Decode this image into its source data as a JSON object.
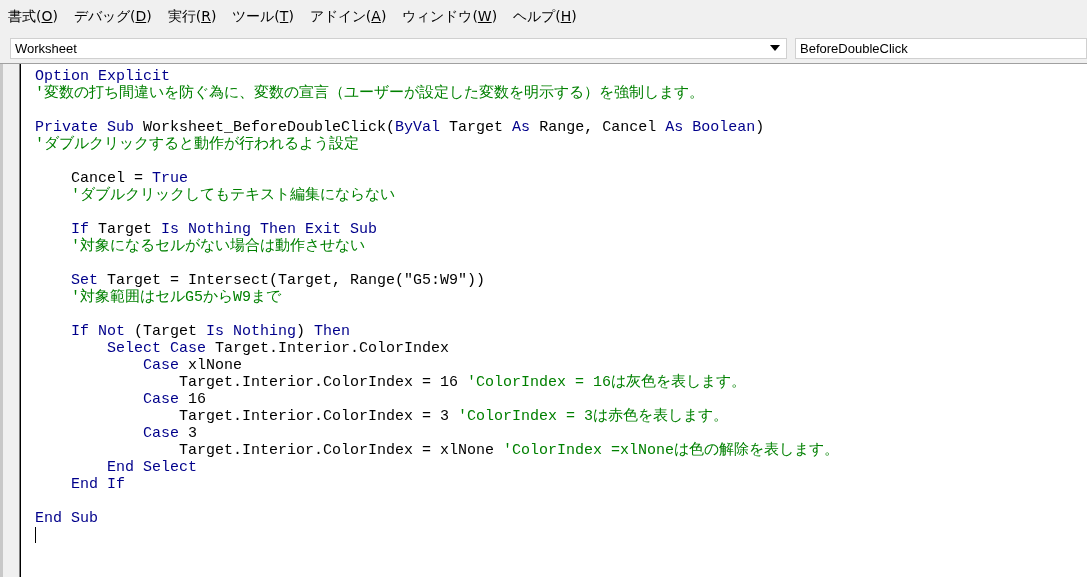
{
  "menu_bar": [
    {
      "before": "書式(",
      "accel": "O",
      "after": ")"
    },
    {
      "before": "デバッグ(",
      "accel": "D",
      "after": ")"
    },
    {
      "before": "実行(",
      "accel": "R",
      "after": ")"
    },
    {
      "before": "ツール(",
      "accel": "T",
      "after": ")"
    },
    {
      "before": "アドイン(",
      "accel": "A",
      "after": ")"
    },
    {
      "before": "ウィンドウ(",
      "accel": "W",
      "after": ")"
    },
    {
      "before": "ヘルプ(",
      "accel": "H",
      "after": ")"
    }
  ],
  "object_dropdown": {
    "value": "Worksheet"
  },
  "procedure_dropdown": {
    "value": "BeforeDoubleClick"
  },
  "code_lines": [
    {
      "kind": "code",
      "tokens": [
        {
          "kind": "keyword",
          "text": "Option Explicit"
        }
      ]
    },
    {
      "kind": "code",
      "tokens": [
        {
          "kind": "comment",
          "text": "'変数の打ち間違いを防ぐ為に、変数の宣言（ユーザーが設定した変数を明示する）を強制します。"
        }
      ]
    },
    {
      "kind": "blank"
    },
    {
      "kind": "code",
      "tokens": [
        {
          "kind": "keyword",
          "text": "Private Sub"
        },
        {
          "kind": "text",
          "text": " Worksheet_BeforeDoubleClick("
        },
        {
          "kind": "keyword",
          "text": "ByVal"
        },
        {
          "kind": "text",
          "text": " Target "
        },
        {
          "kind": "keyword",
          "text": "As"
        },
        {
          "kind": "text",
          "text": " Range, Cancel "
        },
        {
          "kind": "keyword",
          "text": "As Boolean"
        },
        {
          "kind": "text",
          "text": ")"
        }
      ]
    },
    {
      "kind": "code",
      "tokens": [
        {
          "kind": "comment",
          "text": "'ダブルクリックすると動作が行われるよう設定"
        }
      ]
    },
    {
      "kind": "blank"
    },
    {
      "kind": "code",
      "tokens": [
        {
          "kind": "text",
          "text": "    Cancel = "
        },
        {
          "kind": "keyword",
          "text": "True"
        }
      ]
    },
    {
      "kind": "code",
      "tokens": [
        {
          "kind": "comment",
          "text": "    'ダブルクリックしてもテキスト編集にならない"
        }
      ]
    },
    {
      "kind": "blank"
    },
    {
      "kind": "code",
      "tokens": [
        {
          "kind": "keyword",
          "text": "    If"
        },
        {
          "kind": "text",
          "text": " Target "
        },
        {
          "kind": "keyword",
          "text": "Is Nothing Then Exit Sub"
        }
      ]
    },
    {
      "kind": "code",
      "tokens": [
        {
          "kind": "comment",
          "text": "    '対象になるセルがない場合は動作させない"
        }
      ]
    },
    {
      "kind": "blank"
    },
    {
      "kind": "code",
      "tokens": [
        {
          "kind": "keyword",
          "text": "    Set"
        },
        {
          "kind": "text",
          "text": " Target = Intersect(Target, Range(\"G5:W9\"))"
        }
      ]
    },
    {
      "kind": "code",
      "tokens": [
        {
          "kind": "comment",
          "text": "    '対象範囲はセルG5からW9まで"
        }
      ]
    },
    {
      "kind": "blank"
    },
    {
      "kind": "code",
      "tokens": [
        {
          "kind": "keyword",
          "text": "    If Not"
        },
        {
          "kind": "text",
          "text": " (Target "
        },
        {
          "kind": "keyword",
          "text": "Is Nothing"
        },
        {
          "kind": "text",
          "text": ") "
        },
        {
          "kind": "keyword",
          "text": "Then"
        }
      ]
    },
    {
      "kind": "code",
      "tokens": [
        {
          "kind": "keyword",
          "text": "        Select Case"
        },
        {
          "kind": "text",
          "text": " Target.Interior.ColorIndex"
        }
      ]
    },
    {
      "kind": "code",
      "tokens": [
        {
          "kind": "keyword",
          "text": "            Case"
        },
        {
          "kind": "text",
          "text": " xlNone"
        }
      ]
    },
    {
      "kind": "code",
      "tokens": [
        {
          "kind": "text",
          "text": "                Target.Interior.ColorIndex = 16 "
        },
        {
          "kind": "comment",
          "text": "'ColorIndex = 16は灰色を表します。"
        }
      ]
    },
    {
      "kind": "code",
      "tokens": [
        {
          "kind": "keyword",
          "text": "            Case"
        },
        {
          "kind": "text",
          "text": " 16"
        }
      ]
    },
    {
      "kind": "code",
      "tokens": [
        {
          "kind": "text",
          "text": "                Target.Interior.ColorIndex = 3 "
        },
        {
          "kind": "comment",
          "text": "'ColorIndex = 3は赤色を表します。"
        }
      ]
    },
    {
      "kind": "code",
      "tokens": [
        {
          "kind": "keyword",
          "text": "            Case"
        },
        {
          "kind": "text",
          "text": " 3"
        }
      ]
    },
    {
      "kind": "code",
      "tokens": [
        {
          "kind": "text",
          "text": "                Target.Interior.ColorIndex = xlNone "
        },
        {
          "kind": "comment",
          "text": "'ColorIndex =xlNoneは色の解除を表します。"
        }
      ]
    },
    {
      "kind": "code",
      "tokens": [
        {
          "kind": "keyword",
          "text": "        End Select"
        }
      ]
    },
    {
      "kind": "code",
      "tokens": [
        {
          "kind": "keyword",
          "text": "    End If"
        }
      ]
    },
    {
      "kind": "blank"
    },
    {
      "kind": "code",
      "tokens": [
        {
          "kind": "keyword",
          "text": "End Sub"
        }
      ]
    },
    {
      "kind": "cursor"
    }
  ]
}
